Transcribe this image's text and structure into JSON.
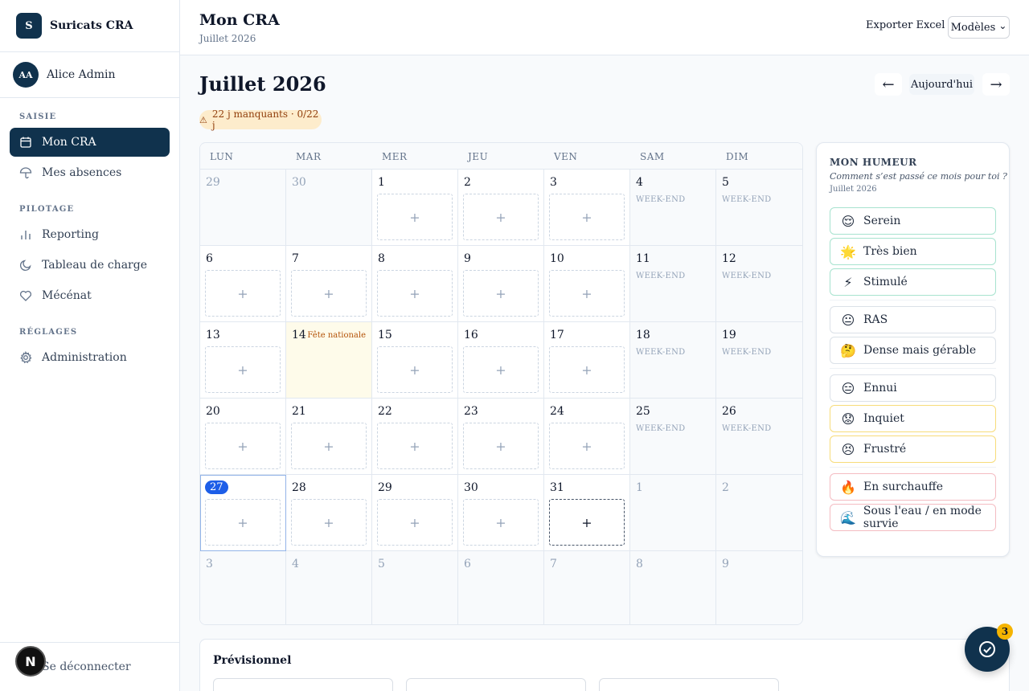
{
  "brand": {
    "logo": "S",
    "name": "Suricats CRA"
  },
  "user": {
    "initials": "AA",
    "name": "Alice Admin"
  },
  "sidebar": {
    "sections": [
      {
        "title": "SAISIE",
        "items": [
          {
            "label": "Mon CRA",
            "icon": "calendar-icon",
            "active": true
          },
          {
            "label": "Mes absences",
            "icon": "umbrella-icon"
          }
        ]
      },
      {
        "title": "PILOTAGE",
        "items": [
          {
            "label": "Reporting",
            "icon": "bar-chart-icon"
          },
          {
            "label": "Tableau de charge",
            "icon": "clock-icon"
          },
          {
            "label": "Mécénat",
            "icon": "heart-icon"
          }
        ]
      },
      {
        "title": "RÉGLAGES",
        "items": [
          {
            "label": "Administration",
            "icon": "gear-icon"
          }
        ]
      }
    ],
    "logout": "Se déconnecter"
  },
  "dev_badge": "N",
  "header": {
    "title": "Mon CRA",
    "subtitle": "Juillet 2026",
    "export_label": "Exporter Excel",
    "models_label": "Modèles",
    "models_chevron": "⌄"
  },
  "calendar": {
    "month_title": "Juillet 2026",
    "prev": "←",
    "today": "Aujourd'hui",
    "next": "→",
    "warning_icon": "⚠",
    "warning": "22 j manquants · 0/22 j",
    "weekdays": [
      "LUN",
      "MAR",
      "MER",
      "JEU",
      "VEN",
      "SAM",
      "DIM"
    ],
    "add_symbol": "+",
    "weekend_label": "WEEK-END",
    "holiday_label": "Fête nationale",
    "weeks": [
      [
        {
          "d": "29",
          "out": true
        },
        {
          "d": "30",
          "out": true
        },
        {
          "d": "1"
        },
        {
          "d": "2"
        },
        {
          "d": "3"
        },
        {
          "d": "4",
          "we": true
        },
        {
          "d": "5",
          "we": true
        }
      ],
      [
        {
          "d": "6"
        },
        {
          "d": "7"
        },
        {
          "d": "8"
        },
        {
          "d": "9"
        },
        {
          "d": "10"
        },
        {
          "d": "11",
          "we": true
        },
        {
          "d": "12",
          "we": true
        }
      ],
      [
        {
          "d": "13"
        },
        {
          "d": "14",
          "holiday": true
        },
        {
          "d": "15"
        },
        {
          "d": "16"
        },
        {
          "d": "17"
        },
        {
          "d": "18",
          "we": true
        },
        {
          "d": "19",
          "we": true
        }
      ],
      [
        {
          "d": "20"
        },
        {
          "d": "21"
        },
        {
          "d": "22"
        },
        {
          "d": "23"
        },
        {
          "d": "24"
        },
        {
          "d": "25",
          "we": true
        },
        {
          "d": "26",
          "we": true
        }
      ],
      [
        {
          "d": "27",
          "today": true
        },
        {
          "d": "28"
        },
        {
          "d": "29"
        },
        {
          "d": "30"
        },
        {
          "d": "31",
          "hover": true
        },
        {
          "d": "1",
          "out": true
        },
        {
          "d": "2",
          "out": true
        }
      ],
      [
        {
          "d": "3",
          "out": true
        },
        {
          "d": "4",
          "out": true
        },
        {
          "d": "5",
          "out": true
        },
        {
          "d": "6",
          "out": true
        },
        {
          "d": "7",
          "out": true
        },
        {
          "d": "8",
          "out": true
        },
        {
          "d": "9",
          "out": true
        }
      ]
    ]
  },
  "mood": {
    "title": "MON HUMEUR",
    "question": "Comment s’est passé ce mois pour toi ?",
    "month": "Juillet 2026",
    "groups": [
      [
        {
          "emoji": "😌",
          "label": "Serein",
          "tone": "g"
        },
        {
          "emoji": "🌟",
          "label": "Très bien",
          "tone": "g"
        },
        {
          "emoji": "⚡",
          "label": "Stimulé",
          "tone": "g"
        }
      ],
      [
        {
          "emoji": "😐",
          "label": "RAS",
          "tone": "n"
        },
        {
          "emoji": "🤔",
          "label": "Dense mais gérable",
          "tone": "n"
        }
      ],
      [
        {
          "emoji": "😑",
          "label": "Ennui",
          "tone": "n"
        },
        {
          "emoji": "😟",
          "label": "Inquiet",
          "tone": "y"
        },
        {
          "emoji": "😣",
          "label": "Frustré",
          "tone": "y"
        }
      ],
      [
        {
          "emoji": "🔥",
          "label": "En surchauffe",
          "tone": "r"
        },
        {
          "emoji": "🌊",
          "label": "Sous l'eau / en mode survie",
          "tone": "r"
        }
      ]
    ]
  },
  "forecast": {
    "title": "Prévisionnel"
  },
  "fab": {
    "badge": "3",
    "icon": "check-circle-icon"
  }
}
